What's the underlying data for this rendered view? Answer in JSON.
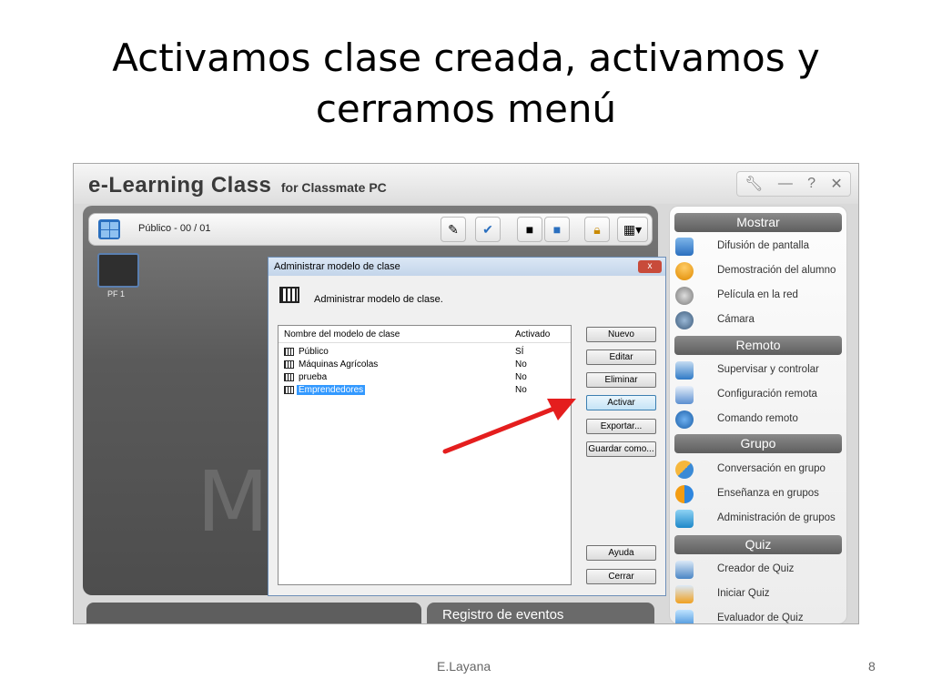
{
  "slide": {
    "title_line1": "Activamos clase creada, activamos  y",
    "title_line2": "cerramos menú",
    "author": "E.Layana",
    "page": "8"
  },
  "app": {
    "brand_main": "e-Learning Class",
    "brand_sub": "for Classmate PC",
    "window_controls": [
      "wrench-icon",
      "minimize-icon",
      "help-icon",
      "close-icon"
    ],
    "toolbar": {
      "group_label": "Público - 00 / 01"
    },
    "students": [
      {
        "label": "PF 1"
      }
    ],
    "watermark": "My",
    "event_log_label": "Registro de eventos"
  },
  "dialog": {
    "title": "Administrar modelo de clase",
    "close_label": "x",
    "description": "Administrar modelo de clase.",
    "columns": [
      "Nombre del modelo de clase",
      "Activado"
    ],
    "rows": [
      {
        "name": "Público",
        "active": "SÍ"
      },
      {
        "name": "Máquinas Agrícolas",
        "active": "No"
      },
      {
        "name": "prueba",
        "active": "No"
      },
      {
        "name": "Emprendedores",
        "active": "No"
      }
    ],
    "selected_row": "Emprendedores",
    "buttons": {
      "nuevo": "Nuevo",
      "editar": "Editar",
      "eliminar": "Eliminar",
      "activar": "Activar",
      "exportar": "Exportar...",
      "guardar": "Guardar como...",
      "ayuda": "Ayuda",
      "cerrar": "Cerrar"
    }
  },
  "sidebar": {
    "mostrar": "Mostrar",
    "mostrar_items": [
      "Difusión de pantalla",
      "Demostración del alumno",
      "Película en la red",
      "Cámara"
    ],
    "remoto": "Remoto",
    "remoto_items": [
      "Supervisar y controlar",
      "Configuración remota",
      "Comando remoto"
    ],
    "grupo": "Grupo",
    "grupo_items": [
      "Conversación en grupo",
      "Enseñanza en grupos",
      "Administración de grupos"
    ],
    "quiz": "Quiz",
    "quiz_items": [
      "Creador de Quiz",
      "Iniciar Quiz",
      "Evaluador de Quiz"
    ]
  },
  "colors": {
    "annotation_arrow": "#e41e1e",
    "selection": "#3399ff",
    "section_header": "#6e6e6e"
  }
}
